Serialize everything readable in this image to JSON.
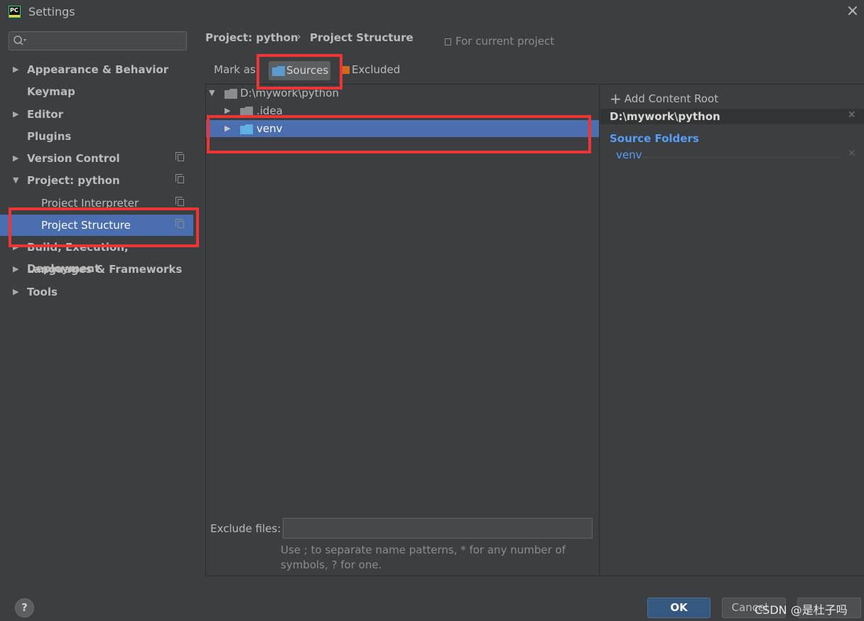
{
  "window": {
    "title": "Settings",
    "app_icon": "PC"
  },
  "search": {
    "placeholder": ""
  },
  "sidebar": {
    "items": [
      {
        "label": "Appearance & Behavior",
        "expandable": true
      },
      {
        "label": "Keymap"
      },
      {
        "label": "Editor",
        "expandable": true
      },
      {
        "label": "Plugins"
      },
      {
        "label": "Version Control",
        "expandable": true
      },
      {
        "label": "Project: python",
        "expanded": true
      },
      {
        "label": "Project Interpreter"
      },
      {
        "label": "Project Structure",
        "selected": true
      },
      {
        "label": "Build, Execution, Deployment",
        "expandable": true
      },
      {
        "label": "Languages & Frameworks",
        "expandable": true
      },
      {
        "label": "Tools",
        "expandable": true
      }
    ]
  },
  "header": {
    "breadcrumb": [
      "Project: python",
      "Project Structure"
    ],
    "separator": "›",
    "scope": "For current project"
  },
  "mark_as": {
    "label": "Mark as:",
    "sources": "Sources",
    "excluded": "Excluded"
  },
  "tree": {
    "root": "D:\\mywork\\python",
    "children": [
      ".idea",
      "venv"
    ]
  },
  "roots": {
    "add_label": "Add Content Root",
    "path": "D:\\mywork\\python",
    "source_folders_title": "Source Folders",
    "source_folders": [
      "venv"
    ]
  },
  "exclude": {
    "label": "Exclude files:",
    "value": "",
    "hint_line1": "Use ; to separate name patterns, * for any number of",
    "hint_line2": "symbols, ? for one."
  },
  "buttons": {
    "help": "?",
    "ok": "OK",
    "cancel": "Cancel",
    "apply": ""
  },
  "watermark": "CSDN @是杜子吗",
  "colors": {
    "accent": "#4b6eaf",
    "highlight": "#ee3434",
    "link": "#589df6"
  }
}
